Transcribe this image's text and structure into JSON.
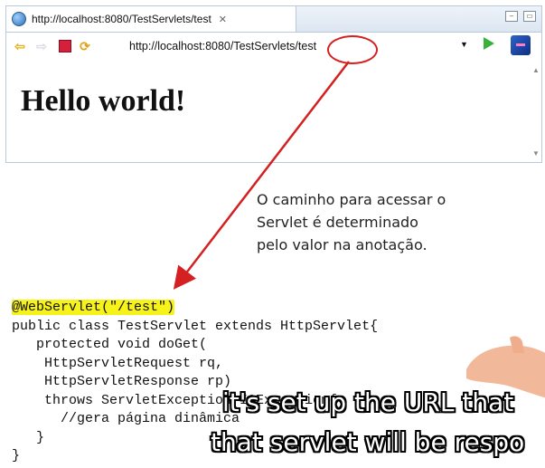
{
  "browser": {
    "tab_title": "http://localhost:8080/TestServlets/test",
    "tab_close": "✕",
    "url": "http://localhost:8080/TestServlets/test",
    "page_heading": "Hello world!"
  },
  "annotation": {
    "note_lines": [
      "O caminho para acessar o",
      "Servlet é determinado",
      "pelo valor na anotação."
    ],
    "highlight_color": "#f6f21a",
    "circle_color": "#d42020"
  },
  "code": {
    "annotation_line": "@WebServlet(\"/test\")",
    "lines": [
      "public class TestServlet extends HttpServlet{",
      "   protected void doGet(",
      "    HttpServletRequest rq,",
      "    HttpServletResponse rp)",
      "    throws ServletException,IOException{",
      "      //gera página dinâmica",
      "   }",
      "}"
    ]
  },
  "subtitles": {
    "line1": "it's set up the URL that",
    "line2": "that servlet will be respo"
  },
  "icons": [
    "globe-icon",
    "back-icon",
    "forward-icon",
    "stop-icon",
    "refresh-icon",
    "dropdown-icon",
    "go-icon",
    "extension-icon",
    "hand-icon"
  ]
}
